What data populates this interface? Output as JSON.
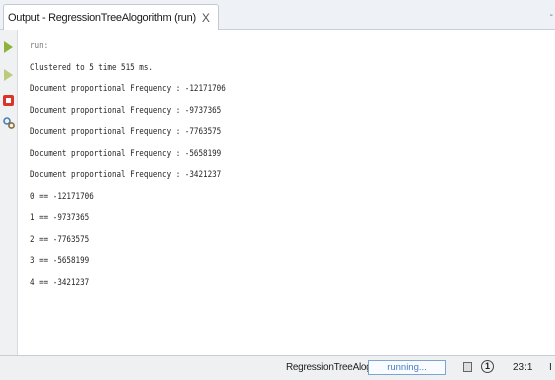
{
  "tab": {
    "title": "Output - RegressionTreeAlogorithm (run)",
    "close": "X"
  },
  "tabbar_edge": "-",
  "output": {
    "lines": [
      "run:",
      "Clustered to 5 time 515 ms.",
      "Document proportional Frequency : -12171706",
      "Document proportional Frequency : -9737365",
      "Document proportional Frequency : -7763575",
      "Document proportional Frequency : -5658199",
      "Document proportional Frequency : -3421237",
      "0 == -12171706",
      "1 == -9737365",
      "2 == -7763575",
      "3 == -5658199",
      "4 == -3421237"
    ]
  },
  "statusbar": {
    "task": "RegressionTreeAlogorithm (run)",
    "progress_label": "running...",
    "info_label": "1",
    "position": "23:1",
    "edge": "I"
  },
  "colors": {
    "rerun": "#8db33a",
    "rerun_alt": "#b9cc7a",
    "stop": "#d9352b",
    "settings": "#4a7fb0"
  }
}
